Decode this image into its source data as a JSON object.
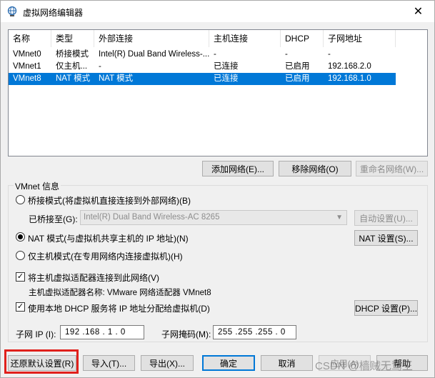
{
  "window": {
    "title": "虚拟网络编辑器",
    "close_glyph": "✕"
  },
  "table": {
    "columns": [
      "名称",
      "类型",
      "外部连接",
      "主机连接",
      "DHCP",
      "子网地址"
    ],
    "rows": [
      [
        "VMnet0",
        "桥接模式",
        "Intel(R) Dual Band Wireless-...",
        "-",
        "-",
        "-"
      ],
      [
        "VMnet1",
        "仅主机...",
        "-",
        "已连接",
        "已启用",
        "192.168.2.0"
      ],
      [
        "VMnet8",
        "NAT 模式",
        "NAT 模式",
        "已连接",
        "已启用",
        "192.168.1.0"
      ]
    ],
    "selected_row": 2
  },
  "table_buttons": {
    "add": "添加网络(E)...",
    "remove": "移除网络(O)",
    "rename": "重命名网络(W)..."
  },
  "vmnet_info": {
    "legend": "VMnet 信息",
    "bridged_label": "桥接模式(将虚拟机直接连接到外部网络)(B)",
    "bridged_to_label": "已桥接至(G):",
    "bridged_to_value": "Intel(R) Dual Band Wireless-AC 8265",
    "auto_settings": "自动设置(U)...",
    "nat_label": "NAT 模式(与虚拟机共享主机的 IP 地址)(N)",
    "nat_settings": "NAT 设置(S)...",
    "hostonly_label": "仅主机模式(在专用网络内连接虚拟机)(H)",
    "connect_adapter_label": "将主机虚拟适配器连接到此网络(V)",
    "adapter_name_label": "主机虚拟适配器名称: VMware 网络适配器 VMnet8",
    "dhcp_label": "使用本地 DHCP 服务将 IP 地址分配给虚拟机(D)",
    "dhcp_settings": "DHCP 设置(P)...",
    "subnet_ip_label": "子网 IP (I):",
    "subnet_ip_value": "192 .168 . 1 . 0",
    "subnet_mask_label": "子网掩码(M):",
    "subnet_mask_value": "255 .255 .255 . 0",
    "selected_mode": "nat",
    "connect_adapter_checked": true,
    "dhcp_checked": true
  },
  "footer": {
    "restore": "还原默认设置(R)",
    "import": "导入(T)...",
    "export": "导出(X)...",
    "ok": "确定",
    "cancel": "取消",
    "apply": "应用(A)",
    "help": "帮助"
  },
  "watermark": "CSDN @樯贼无鸷王",
  "colors": {
    "selection": "#0078d7",
    "highlight_frame": "#e0201b"
  },
  "icons": {
    "app": "network-globe-icon",
    "close": "close-icon"
  }
}
